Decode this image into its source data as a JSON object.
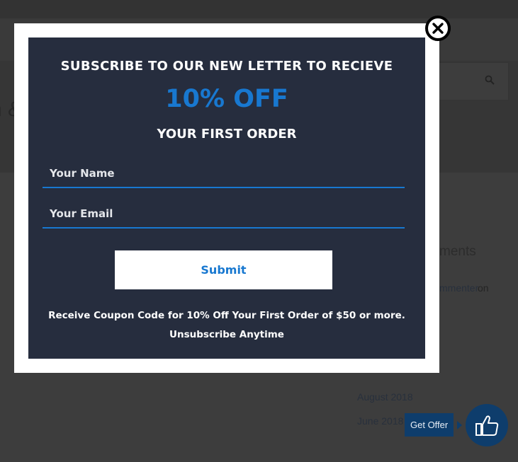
{
  "background": {
    "hero_title_fragment": "n &",
    "widget_title": "ments",
    "recent_comment_author": "mmenter",
    "recent_comment_on": "on",
    "archives": [
      "August 2018",
      "June 2018"
    ]
  },
  "modal": {
    "headline": "SUBSCRIBE TO OUR NEW LETTER TO RECIEVE",
    "discount": "10% OFF",
    "subline": "YOUR FIRST ORDER",
    "name_placeholder": "Your Name",
    "email_placeholder": "Your Email",
    "submit_label": "Submit",
    "note_line1": "Receive Coupon Code for 10% Off Your First Order of $50 or more.",
    "note_line2": "Unsubscribe Anytime",
    "accent_color": "#1878d0",
    "panel_color": "#262d3e"
  },
  "offer": {
    "label": "Get Offer",
    "icon": "thumbs-up-icon"
  }
}
